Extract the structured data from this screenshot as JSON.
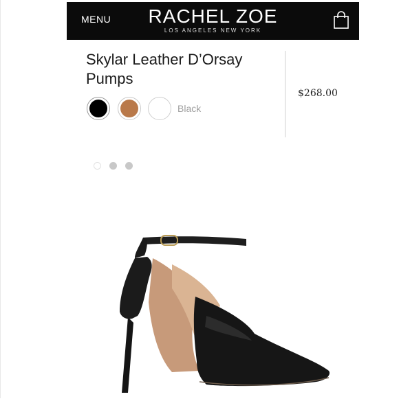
{
  "header": {
    "menu_label": "MENU",
    "brand_name": "RACHEL ZOE",
    "brand_tagline": "LOS ANGELES  NEW YORK",
    "cart_icon": "shopping-bag-icon"
  },
  "product": {
    "name": "Skylar Leather D’Orsay Pumps",
    "price": "$268.00",
    "selected_color_label": "Black",
    "colors": [
      {
        "name": "black",
        "hex": "#000000"
      },
      {
        "name": "cognac",
        "hex": "#b9794a"
      },
      {
        "name": "white",
        "hex": "#ffffff"
      }
    ]
  },
  "carousel": {
    "slide_count": 3,
    "active_index": 0
  }
}
